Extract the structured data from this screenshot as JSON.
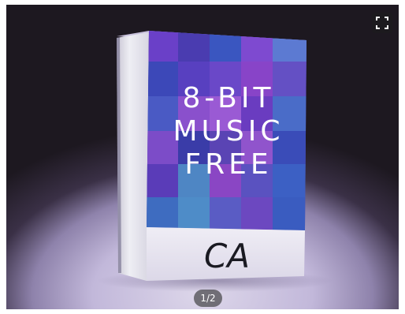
{
  "product": {
    "title_lines": [
      "8-BIT",
      "MUSIC",
      "FREE"
    ],
    "logo_text": "CA"
  },
  "viewer": {
    "counter": "1/2",
    "fullscreen_icon": "fullscreen-icon"
  }
}
